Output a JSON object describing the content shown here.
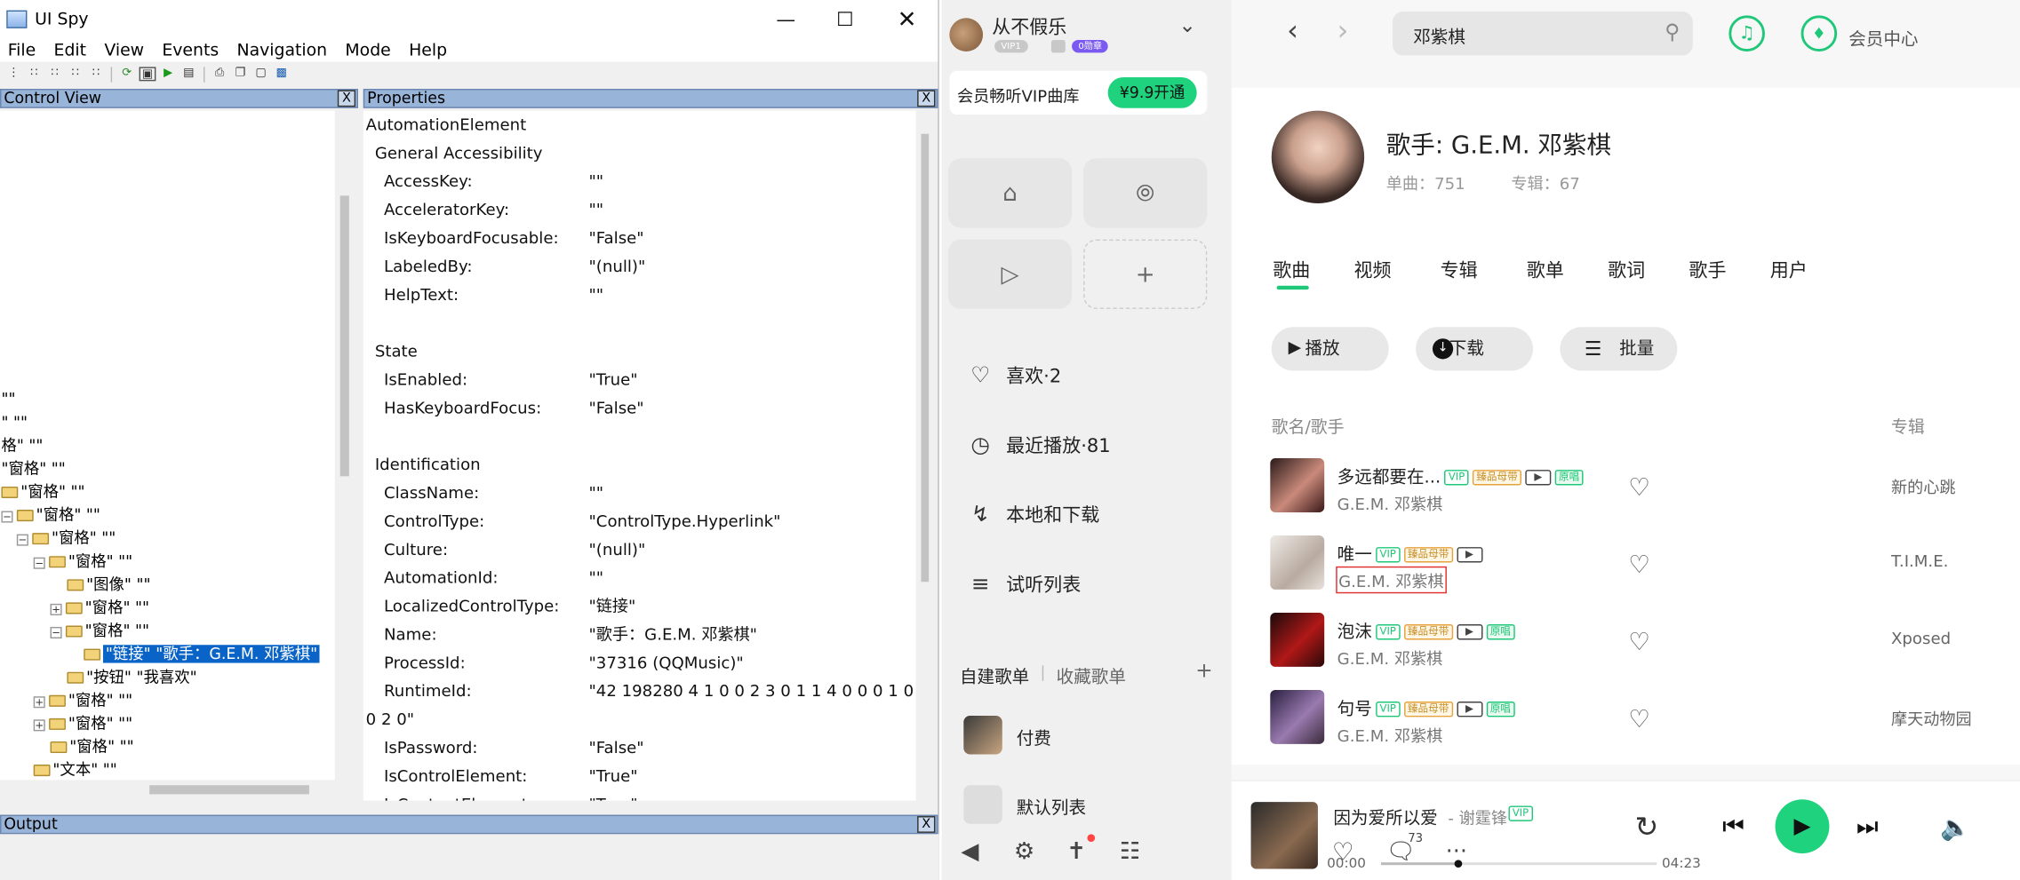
{
  "spy": {
    "title": "UI Spy",
    "menu": [
      "File",
      "Edit",
      "View",
      "Events",
      "Navigation",
      "Mode",
      "Help"
    ],
    "control_view_title": "Control View",
    "properties_title": "Properties",
    "output_title": "Output",
    "close_glyph": "X",
    "tree": [
      {
        "text": "\"\""
      },
      {
        "text": "\" \"\""
      },
      {
        "text": "格\" \"\""
      },
      {
        "text": "\"窗格\" \"\""
      },
      {
        "text": "\"窗格\" \"\""
      },
      {
        "text": "\"窗格\" \"\""
      },
      {
        "text": "\"窗格\" \"\""
      },
      {
        "text": "\"窗格\" \"\""
      },
      {
        "text": "\"图像\" \"\""
      },
      {
        "text": "\"窗格\" \"\""
      },
      {
        "text": "\"窗格\" \"\""
      },
      {
        "text": "\"链接\" \"歌手：G.E.M. 邓紫棋\""
      },
      {
        "text": "\"按钮\" \"我喜欢\""
      },
      {
        "text": "\"窗格\" \"\""
      },
      {
        "text": "\"窗格\" \"\""
      },
      {
        "text": "\"窗格\" \"\""
      },
      {
        "text": "\"文本\" \"\""
      }
    ],
    "properties": [
      {
        "name": "AutomationElement",
        "value": ""
      },
      {
        "name": "General Accessibility",
        "value": ""
      },
      {
        "name": "AccessKey:",
        "value": "\"\""
      },
      {
        "name": "AcceleratorKey:",
        "value": "\"\""
      },
      {
        "name": "IsKeyboardFocusable:",
        "value": "\"False\""
      },
      {
        "name": "LabeledBy:",
        "value": "\"(null)\""
      },
      {
        "name": "HelpText:",
        "value": "\"\""
      },
      {
        "name": "State",
        "value": ""
      },
      {
        "name": "IsEnabled:",
        "value": "\"True\""
      },
      {
        "name": "HasKeyboardFocus:",
        "value": "\"False\""
      },
      {
        "name": "Identification",
        "value": ""
      },
      {
        "name": "ClassName:",
        "value": "\"\""
      },
      {
        "name": "ControlType:",
        "value": "\"ControlType.Hyperlink\""
      },
      {
        "name": "Culture:",
        "value": "\"(null)\""
      },
      {
        "name": "AutomationId:",
        "value": "\"\""
      },
      {
        "name": "LocalizedControlType:",
        "value": "\"链接\""
      },
      {
        "name": "Name:",
        "value": "\"歌手：G.E.M. 邓紫棋\""
      },
      {
        "name": "ProcessId:",
        "value": "\"37316 (QQMusic)\""
      },
      {
        "name": "RuntimeId:",
        "value": "\"42 198280 4 1 0 0 2 3 0 1 1 4 0 0 0 1 0 1"
      },
      {
        "name": "0 2 0\"",
        "value": ""
      },
      {
        "name": "IsPassword:",
        "value": "\"False\""
      },
      {
        "name": "IsControlElement:",
        "value": "\"True\""
      },
      {
        "name": "IsContentElement:",
        "value": "\"True\""
      }
    ]
  },
  "qq": {
    "username": "从不假乐",
    "vip_badge": "VIP1",
    "level_badge": "0勋章",
    "vip_promo": "会员畅听VIP曲库",
    "vip_button": "¥9.9开通",
    "nav": [
      {
        "label": "喜欢·2",
        "icon": "heart-icon"
      },
      {
        "label": "最近播放·81",
        "icon": "clock-icon"
      },
      {
        "label": "本地和下载",
        "icon": "download-icon"
      },
      {
        "label": "试听列表",
        "icon": "playlist-icon"
      }
    ],
    "playlist_tabs": [
      "自建歌单",
      "收藏歌单"
    ],
    "playlist_add": "+",
    "playlists": [
      "付费",
      "默认列表"
    ],
    "search_value": "邓紫棋",
    "vip_center": "会员中心",
    "artist": {
      "name": "歌手: G.E.M. 邓紫棋",
      "songs_label": "单曲：751",
      "albums_label": "专辑：67"
    },
    "tabs": [
      "歌曲",
      "视频",
      "专辑",
      "歌单",
      "歌词",
      "歌手",
      "用户"
    ],
    "actions": [
      "播放",
      "下载",
      "批量"
    ],
    "col_song": "歌名/歌手",
    "col_album": "专辑",
    "songs": [
      {
        "title": "多远都要在...",
        "artist": "G.E.M. 邓紫棋",
        "album": "新的心跳",
        "vip": "VIP",
        "quality": "臻品母带",
        "orig": "原唱"
      },
      {
        "title": "唯一",
        "artist": "G.E.M. 邓紫棋",
        "album": "T.I.M.E.",
        "vip": "VIP",
        "quality": "臻品母带",
        "orig": ""
      },
      {
        "title": "泡沫",
        "artist": "G.E.M. 邓紫棋",
        "album": "Xposed",
        "vip": "VIP",
        "quality": "臻品母带",
        "orig": "原唱"
      },
      {
        "title": "句号",
        "artist": "G.E.M. 邓紫棋",
        "album": "摩天动物园",
        "vip": "VIP",
        "quality": "臻品母带",
        "orig": "原唱"
      }
    ],
    "player": {
      "title": "因为爱所以爱",
      "artist": "- 谢霆锋",
      "vip": "VIP",
      "comments": "73",
      "time_current": "00:00",
      "time_total": "04:23",
      "progress": 0.28
    },
    "colors": {
      "accent": "#1fc878",
      "selection": "#0a64c8"
    }
  }
}
